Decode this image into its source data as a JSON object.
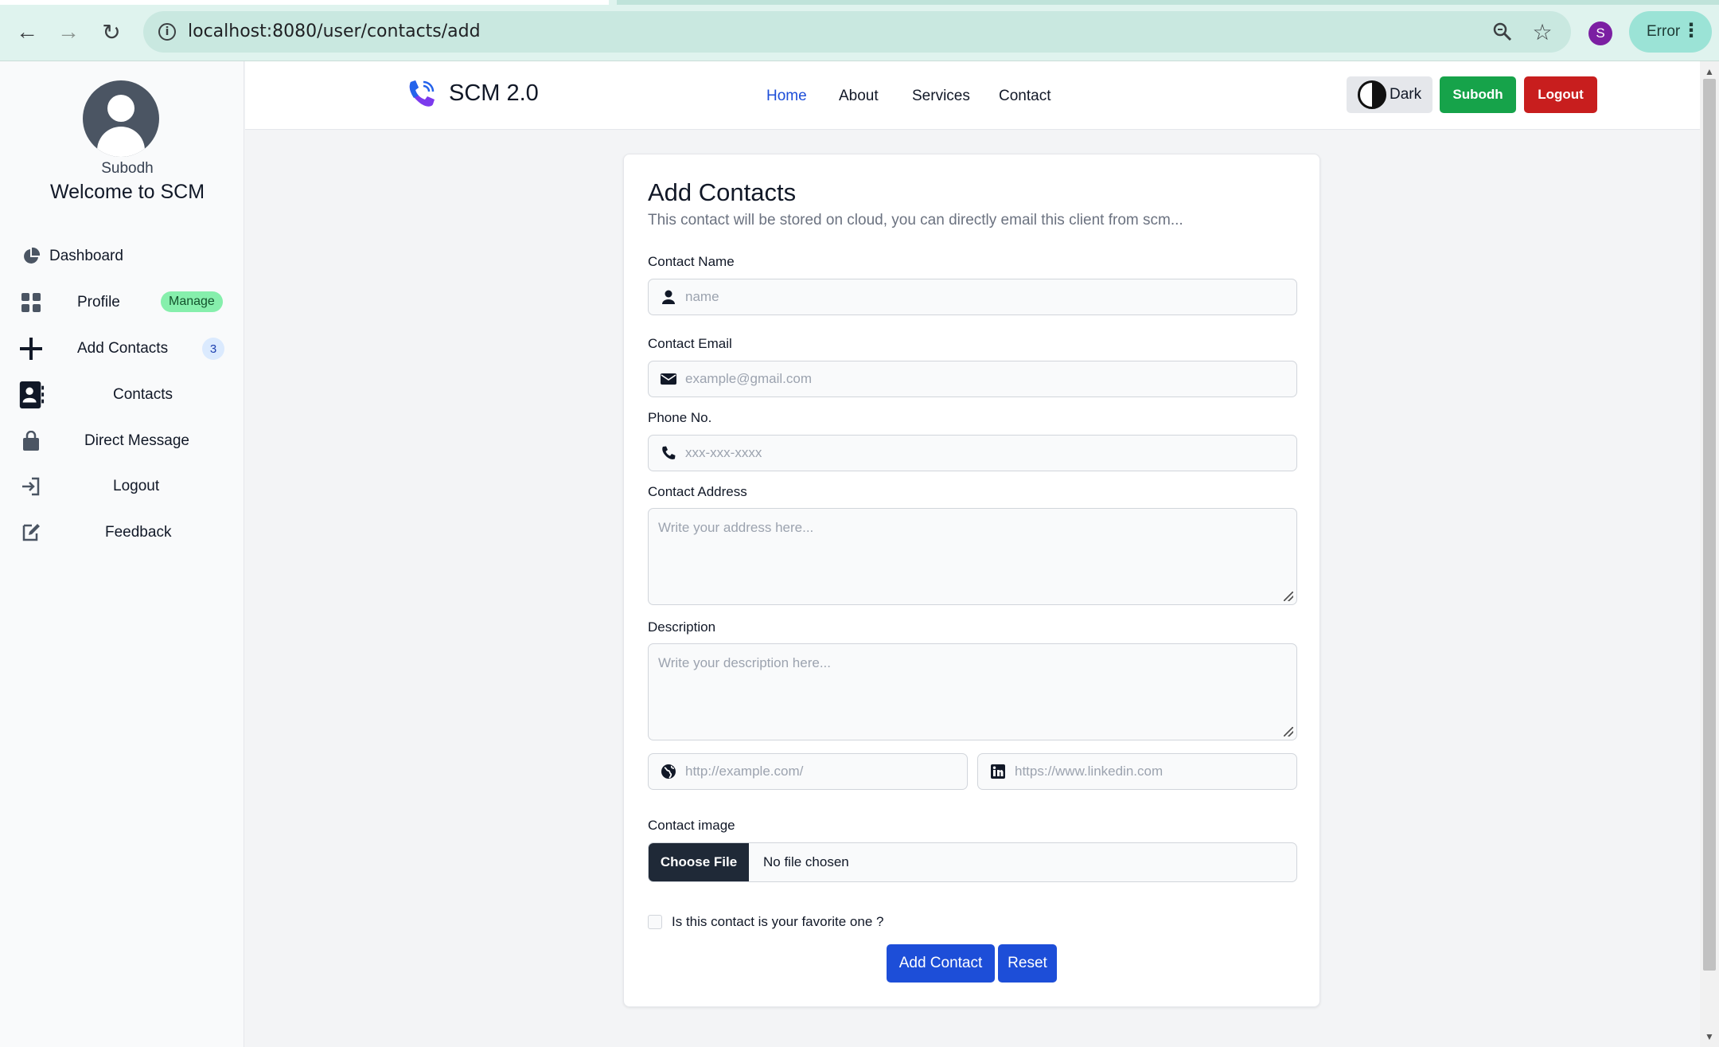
{
  "browser": {
    "url": "localhost:8080/user/contacts/add",
    "profile_initial": "S",
    "error_label": "Error"
  },
  "sidebar": {
    "username": "Subodh",
    "welcome": "Welcome to SCM",
    "items": [
      {
        "label": "Dashboard",
        "icon": "chart-pie-icon"
      },
      {
        "label": "Profile",
        "icon": "grid-icon",
        "badge": "Manage"
      },
      {
        "label": "Add Contacts",
        "icon": "plus-icon",
        "badge": "3"
      },
      {
        "label": "Contacts",
        "icon": "address-book-icon"
      },
      {
        "label": "Direct Message",
        "icon": "bag-icon"
      },
      {
        "label": "Logout",
        "icon": "sign-in-icon"
      },
      {
        "label": "Feedback",
        "icon": "edit-icon"
      }
    ]
  },
  "navbar": {
    "brand": "SCM 2.0",
    "links": [
      "Home",
      "About",
      "Services",
      "Contact"
    ],
    "active_link": "Home",
    "theme_label": "Dark",
    "user_button": "Subodh",
    "logout_button": "Logout",
    "colors": {
      "active": "#1d4ed8",
      "user": "#16a34a",
      "logout": "#c81e1e"
    }
  },
  "form": {
    "title": "Add Contacts",
    "subtitle": "This contact will be stored on cloud, you can directly email this client from scm...",
    "name": {
      "label": "Contact Name",
      "placeholder": "name",
      "value": ""
    },
    "email": {
      "label": "Contact Email",
      "placeholder": "example@gmail.com",
      "value": ""
    },
    "phone": {
      "label": "Phone No.",
      "placeholder": "xxx-xxx-xxxx",
      "value": ""
    },
    "address": {
      "label": "Contact Address",
      "placeholder": "Write your address here...",
      "value": ""
    },
    "description": {
      "label": "Description",
      "placeholder": "Write your description here...",
      "value": ""
    },
    "website": {
      "placeholder": "http://example.com/",
      "value": ""
    },
    "linkedin": {
      "placeholder": "https://www.linkedin.com",
      "value": ""
    },
    "image": {
      "label": "Contact image",
      "button": "Choose File",
      "status": "No file chosen"
    },
    "favorite_label": "Is this contact is your favorite one ?",
    "submit": "Add Contact",
    "reset": "Reset"
  }
}
